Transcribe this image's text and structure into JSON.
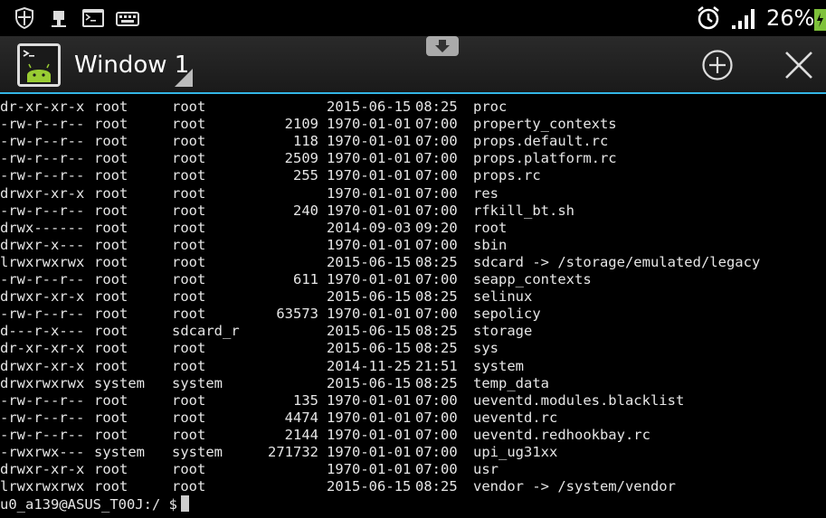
{
  "status_bar": {
    "icons": [
      "shield-icon",
      "usb-icon",
      "terminal-icon",
      "keyboard-icon",
      "alarm-icon",
      "signal-icon",
      "battery-icon"
    ],
    "battery": "26%",
    "battery_color": "#7ec13a"
  },
  "action_bar": {
    "title": "Window 1",
    "accent_color": "#33b5e5"
  },
  "terminal": {
    "rows": [
      {
        "perm": "dr-xr-xr-x",
        "owner": "root",
        "group": "root",
        "size": "",
        "date": "2015-06-15",
        "time": "08:25",
        "name": "proc"
      },
      {
        "perm": "-rw-r--r--",
        "owner": "root",
        "group": "root",
        "size": "2109",
        "date": "1970-01-01",
        "time": "07:00",
        "name": "property_contexts"
      },
      {
        "perm": "-rw-r--r--",
        "owner": "root",
        "group": "root",
        "size": "118",
        "date": "1970-01-01",
        "time": "07:00",
        "name": "props.default.rc"
      },
      {
        "perm": "-rw-r--r--",
        "owner": "root",
        "group": "root",
        "size": "2509",
        "date": "1970-01-01",
        "time": "07:00",
        "name": "props.platform.rc"
      },
      {
        "perm": "-rw-r--r--",
        "owner": "root",
        "group": "root",
        "size": "255",
        "date": "1970-01-01",
        "time": "07:00",
        "name": "props.rc"
      },
      {
        "perm": "drwxr-xr-x",
        "owner": "root",
        "group": "root",
        "size": "",
        "date": "1970-01-01",
        "time": "07:00",
        "name": "res"
      },
      {
        "perm": "-rw-r--r--",
        "owner": "root",
        "group": "root",
        "size": "240",
        "date": "1970-01-01",
        "time": "07:00",
        "name": "rfkill_bt.sh"
      },
      {
        "perm": "drwx------",
        "owner": "root",
        "group": "root",
        "size": "",
        "date": "2014-09-03",
        "time": "09:20",
        "name": "root"
      },
      {
        "perm": "drwxr-x---",
        "owner": "root",
        "group": "root",
        "size": "",
        "date": "1970-01-01",
        "time": "07:00",
        "name": "sbin"
      },
      {
        "perm": "lrwxrwxrwx",
        "owner": "root",
        "group": "root",
        "size": "",
        "date": "2015-06-15",
        "time": "08:25",
        "name": "sdcard -> /storage/emulated/legacy"
      },
      {
        "perm": "-rw-r--r--",
        "owner": "root",
        "group": "root",
        "size": "611",
        "date": "1970-01-01",
        "time": "07:00",
        "name": "seapp_contexts"
      },
      {
        "perm": "drwxr-xr-x",
        "owner": "root",
        "group": "root",
        "size": "",
        "date": "2015-06-15",
        "time": "08:25",
        "name": "selinux"
      },
      {
        "perm": "-rw-r--r--",
        "owner": "root",
        "group": "root",
        "size": "63573",
        "date": "1970-01-01",
        "time": "07:00",
        "name": "sepolicy"
      },
      {
        "perm": "d---r-x---",
        "owner": "root",
        "group": "sdcard_r",
        "size": "",
        "date": "2015-06-15",
        "time": "08:25",
        "name": "storage"
      },
      {
        "perm": "dr-xr-xr-x",
        "owner": "root",
        "group": "root",
        "size": "",
        "date": "2015-06-15",
        "time": "08:25",
        "name": "sys"
      },
      {
        "perm": "drwxr-xr-x",
        "owner": "root",
        "group": "root",
        "size": "",
        "date": "2014-11-25",
        "time": "21:51",
        "name": "system"
      },
      {
        "perm": "drwxrwxrwx",
        "owner": "system",
        "group": "system",
        "size": "",
        "date": "2015-06-15",
        "time": "08:25",
        "name": "temp_data"
      },
      {
        "perm": "-rw-r--r--",
        "owner": "root",
        "group": "root",
        "size": "135",
        "date": "1970-01-01",
        "time": "07:00",
        "name": "ueventd.modules.blacklist"
      },
      {
        "perm": "-rw-r--r--",
        "owner": "root",
        "group": "root",
        "size": "4474",
        "date": "1970-01-01",
        "time": "07:00",
        "name": "ueventd.rc"
      },
      {
        "perm": "-rw-r--r--",
        "owner": "root",
        "group": "root",
        "size": "2144",
        "date": "1970-01-01",
        "time": "07:00",
        "name": "ueventd.redhookbay.rc"
      },
      {
        "perm": "-rwxrwx---",
        "owner": "system",
        "group": "system",
        "size": "271732",
        "date": "1970-01-01",
        "time": "07:00",
        "name": "upi_ug31xx"
      },
      {
        "perm": "drwxr-xr-x",
        "owner": "root",
        "group": "root",
        "size": "",
        "date": "1970-01-01",
        "time": "07:00",
        "name": "usr"
      },
      {
        "perm": "lrwxrwxrwx",
        "owner": "root",
        "group": "root",
        "size": "",
        "date": "2015-06-15",
        "time": "08:25",
        "name": "vendor -> /system/vendor"
      }
    ],
    "prompt": "u0_a139@ASUS_T00J:/ $"
  }
}
